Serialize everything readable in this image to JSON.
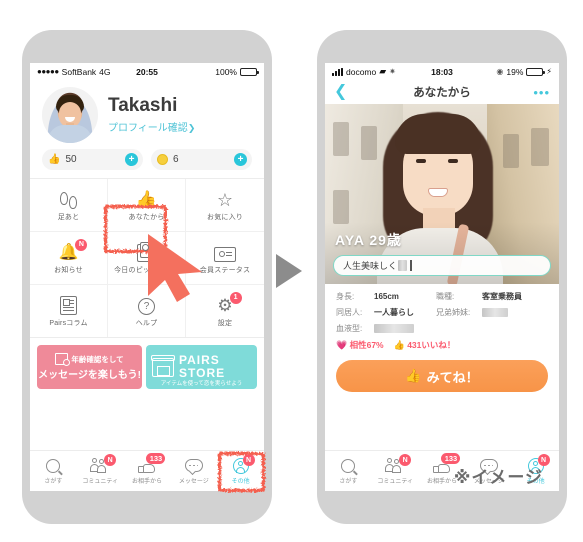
{
  "annotation": {
    "image_note": "※イメージ",
    "highlight_color": "#f4604f",
    "cursor_color": "#f4705e",
    "arrow_color": "#8c8c8c"
  },
  "left_phone": {
    "status_bar": {
      "signal_dots": "●●●●●",
      "carrier": "SoftBank",
      "network": "4G",
      "time": "20:55",
      "battery_pct": "100%"
    },
    "profile": {
      "name": "Takashi",
      "profile_link": "プロフィール確認",
      "chevron": "❯",
      "avatar_name": "user-avatar"
    },
    "counters": [
      {
        "icon": "thumbs-up-icon",
        "glyph": "👍",
        "value": "50",
        "plus": "+"
      },
      {
        "icon": "coin-icon",
        "glyph": "●",
        "value": "6",
        "plus": "+"
      }
    ],
    "grid_menu": [
      {
        "label": "足あと",
        "icon": "footprints-icon",
        "badge": ""
      },
      {
        "label": "あなたから",
        "icon": "thumbs-up-outline-icon",
        "badge": ""
      },
      {
        "label": "お気に入り",
        "icon": "star-icon",
        "badge": ""
      },
      {
        "label": "お知らせ",
        "icon": "bell-icon",
        "badge": "N"
      },
      {
        "label": "今日のピックアップ",
        "icon": "cards-icon",
        "badge": ""
      },
      {
        "label": "会員ステータス",
        "icon": "id-card-icon",
        "badge": ""
      },
      {
        "label": "Pairsコラム",
        "icon": "news-icon",
        "badge": ""
      },
      {
        "label": "ヘルプ",
        "icon": "question-icon",
        "badge": ""
      },
      {
        "label": "設定",
        "icon": "gear-icon",
        "badge": "1"
      }
    ],
    "banners": [
      {
        "id": "age-verification-banner",
        "line1": "年齢確認をして",
        "line2": "メッセージを楽しもう!",
        "color": "#ef8a99"
      },
      {
        "id": "pairs-store-banner",
        "title_line1": "PAIRS",
        "title_line2": "STORE",
        "subtitle": "アイテムを使って恋を実らせよう",
        "color": "#7fdbd9"
      }
    ],
    "tabbar": [
      {
        "label": "さがす",
        "icon": "search-icon",
        "badge": "",
        "active": false
      },
      {
        "label": "コミュニティ",
        "icon": "people-icon",
        "badge": "N",
        "active": false
      },
      {
        "label": "お相手から",
        "icon": "hand-thumb-icon",
        "badge": "133",
        "active": false
      },
      {
        "label": "メッセージ",
        "icon": "chat-bubble-icon",
        "badge": "",
        "active": false
      },
      {
        "label": "その他",
        "icon": "person-circle-icon",
        "badge": "N",
        "active": true
      }
    ]
  },
  "right_phone": {
    "status_bar": {
      "signal": "signal-bars-icon",
      "carrier": "docomo",
      "wifi": "wifi-icon",
      "sync": "sync-icon",
      "time": "18:03",
      "location": "location-icon",
      "battery_pct": "19%",
      "charging": "⚡"
    },
    "navbar": {
      "back": "❮",
      "title": "あなたから",
      "more": "•••"
    },
    "photo_card": {
      "name_age": "AYA 29歳",
      "message_placeholder": "人生美味しく",
      "message_redacted": true
    },
    "attributes": [
      {
        "key": "身長:",
        "value": "165cm",
        "key2": "職種:",
        "value2": "客室乗務員",
        "redacted2": false
      },
      {
        "key": "同居人:",
        "value": "一人暮らし",
        "key2": "兄弟姉妹:",
        "value2": "",
        "redacted2": true
      },
      {
        "key": "血液型:",
        "value": "",
        "redacted": true,
        "key2": "",
        "value2": "",
        "redacted2": false
      }
    ],
    "stats": {
      "compat_icon": "heart-icon",
      "compat_label": "相性67%",
      "likes_icon": "thumbs-up-icon",
      "likes_label": "431いいね！"
    },
    "cta": {
      "icon": "thumbs-up-icon",
      "label": "みてね！",
      "color": "#f79448"
    },
    "tabbar": [
      {
        "label": "さがす",
        "icon": "search-icon",
        "badge": "",
        "active": false
      },
      {
        "label": "コミュニティ",
        "icon": "people-icon",
        "badge": "N",
        "active": false
      },
      {
        "label": "お相手から",
        "icon": "hand-thumb-icon",
        "badge": "133",
        "active": false
      },
      {
        "label": "メッセージ",
        "icon": "chat-bubble-icon",
        "badge": "",
        "active": false
      },
      {
        "label": "その他",
        "icon": "person-circle-icon",
        "badge": "N",
        "active": true
      }
    ]
  }
}
